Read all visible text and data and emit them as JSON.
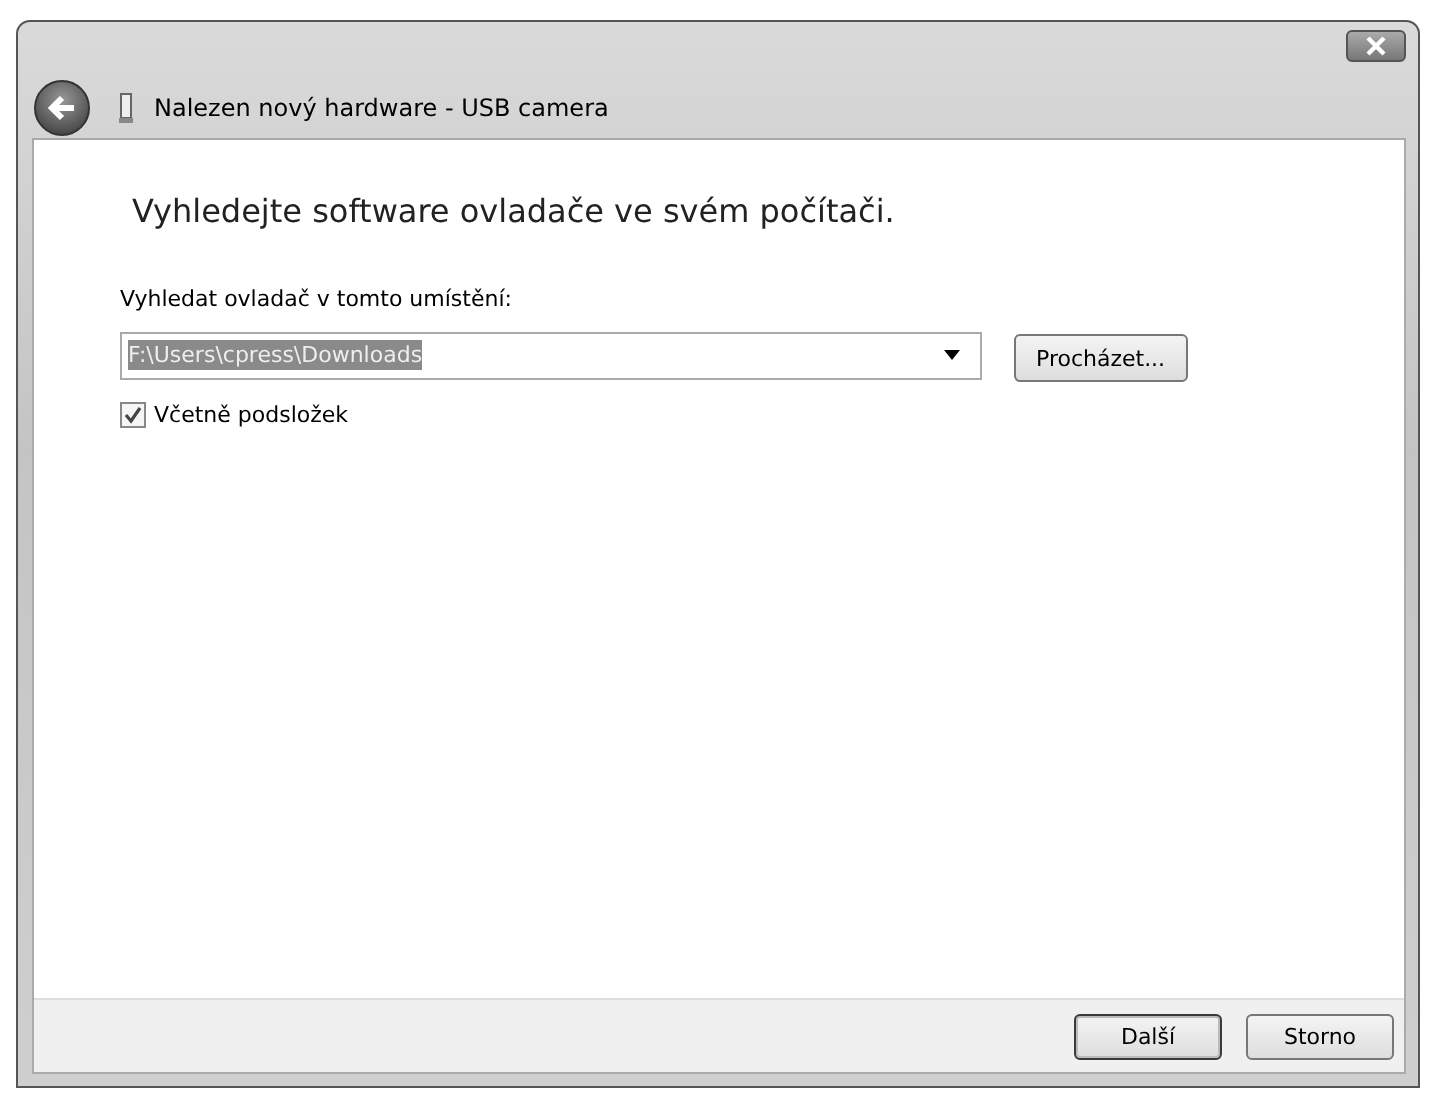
{
  "window": {
    "title": "Nalezen nový hardware - USB camera"
  },
  "heading": "Vyhledejte software ovladače ve svém počítači.",
  "location": {
    "label": "Vyhledat ovladač v tomto umístění:",
    "value": "F:\\Users\\cpress\\Downloads",
    "value_selected": true,
    "browse_button": "Procházet..."
  },
  "include_subfolders": {
    "label": "Včetně podsložek",
    "checked": true
  },
  "buttons": [
    {
      "label": "Další",
      "default": true
    },
    {
      "label": "Storno",
      "default": false
    }
  ]
}
